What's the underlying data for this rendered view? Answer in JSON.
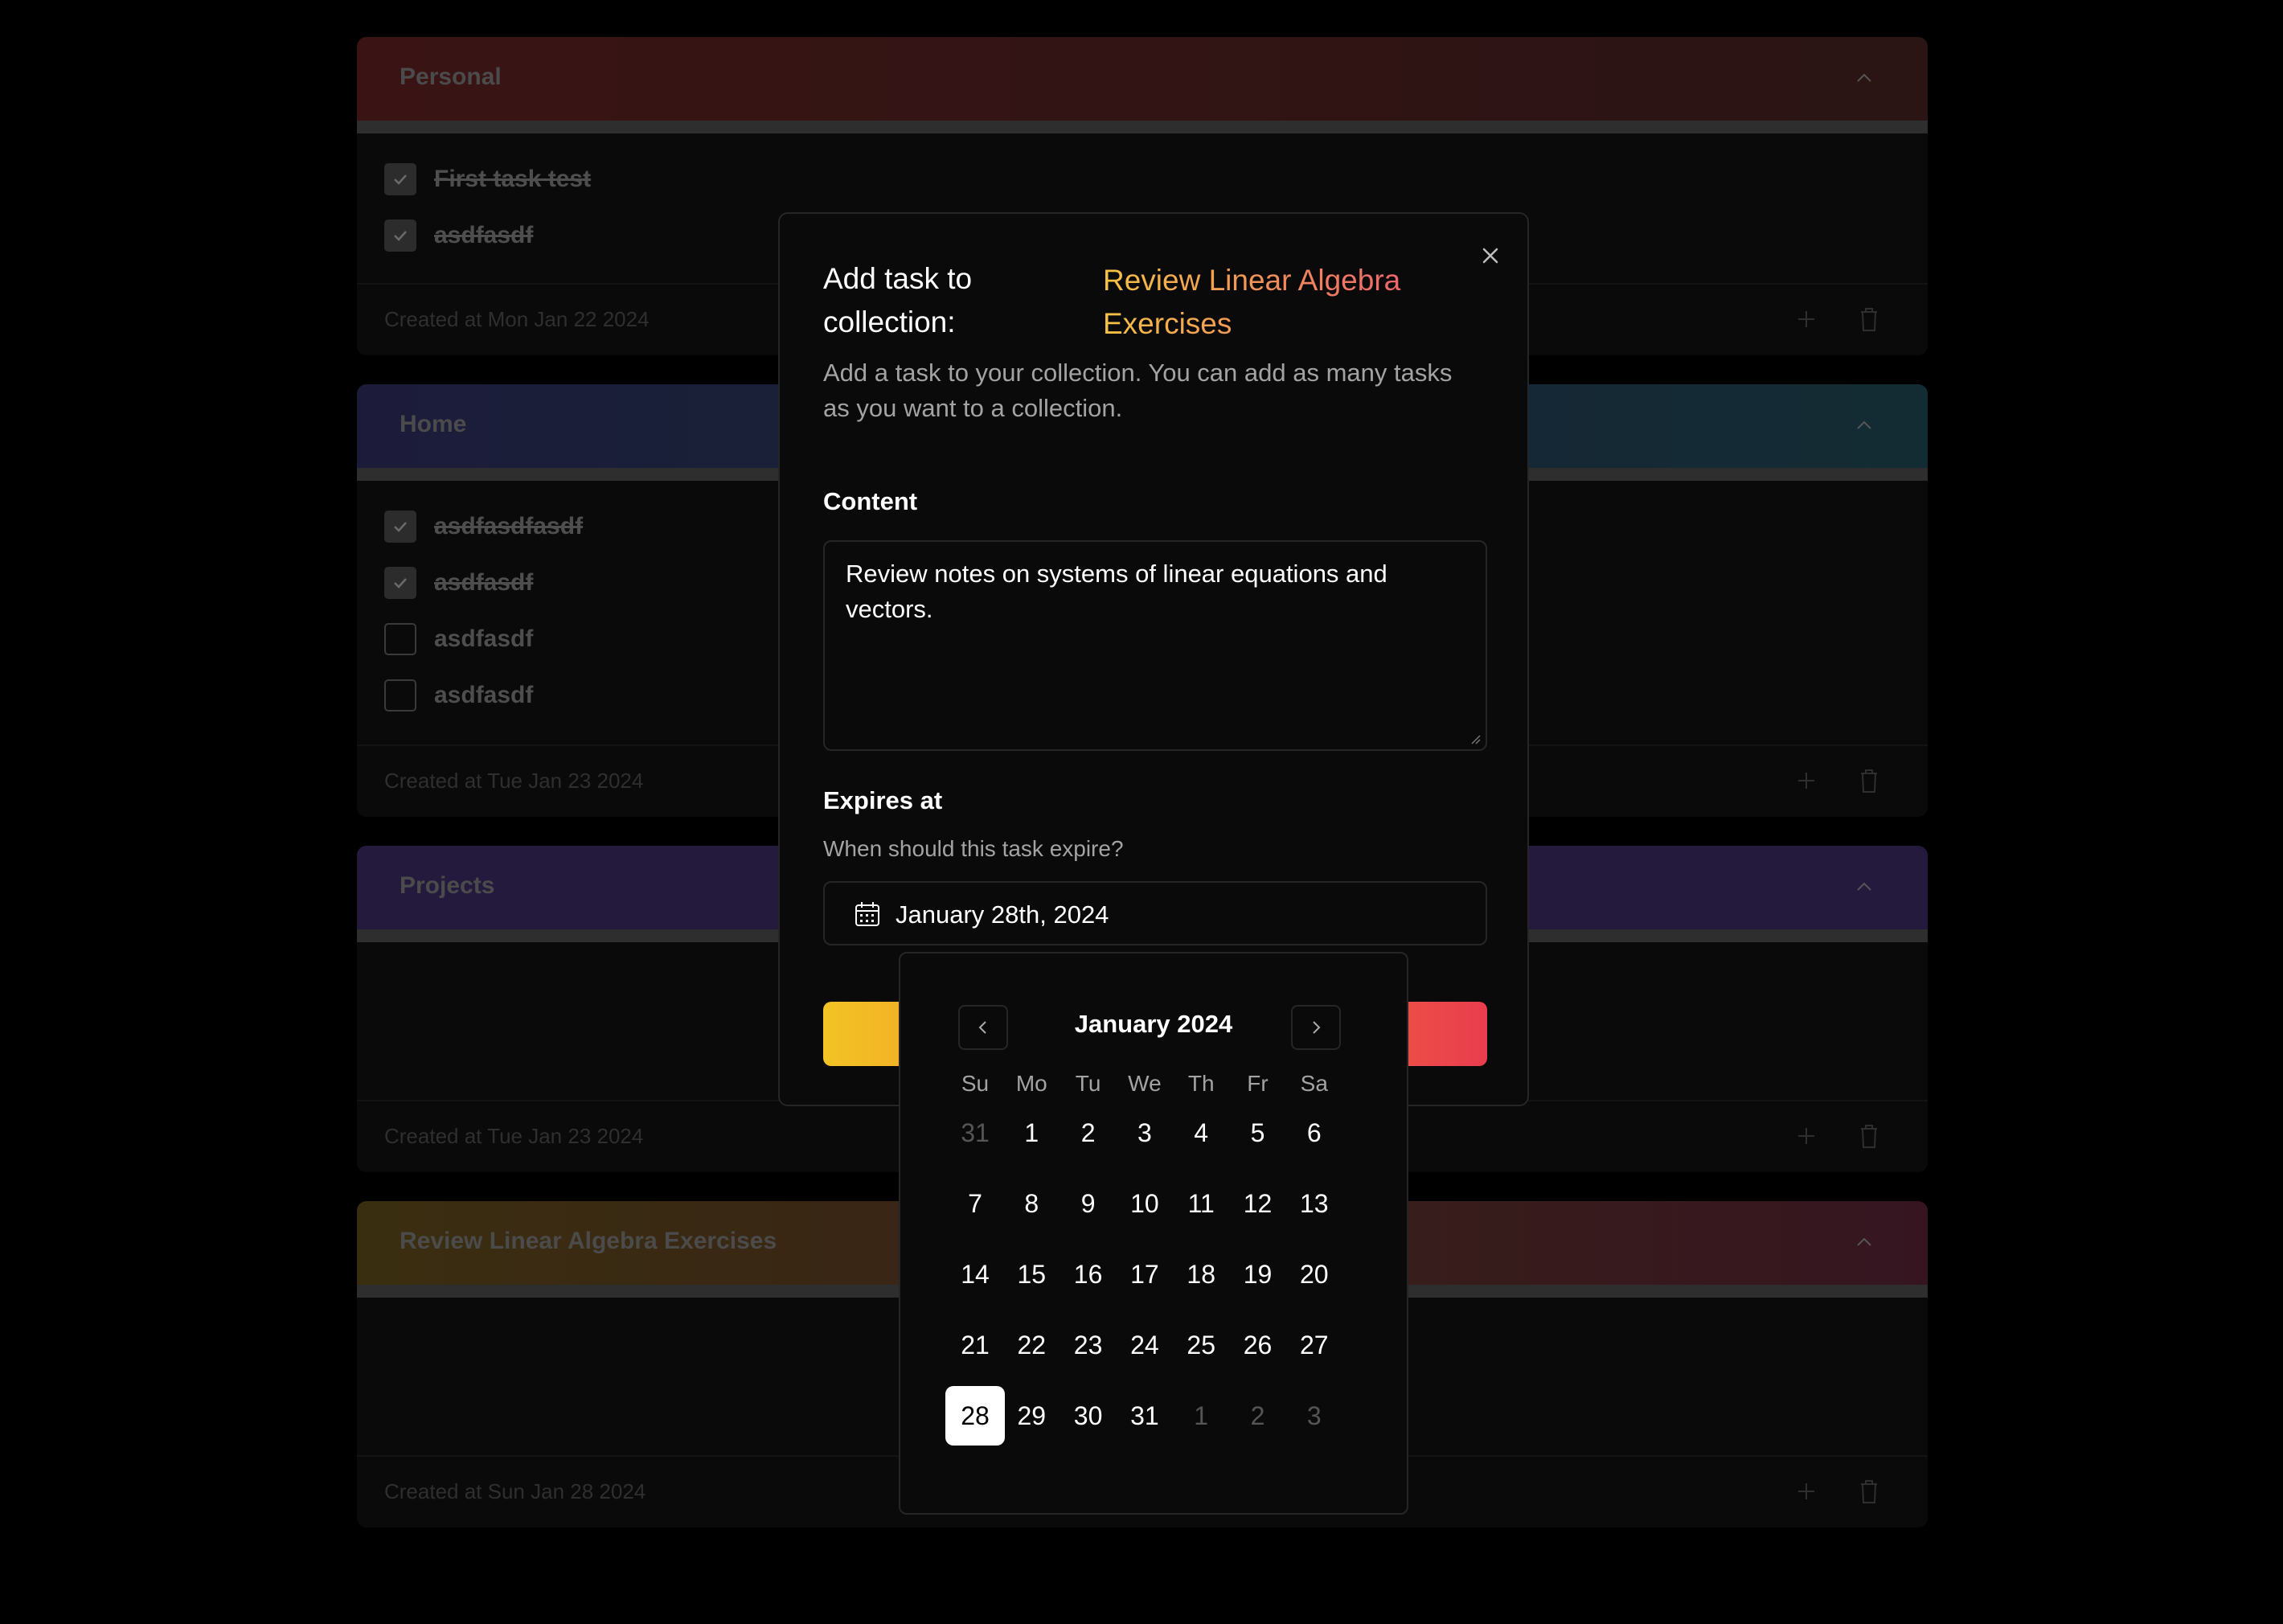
{
  "collections": [
    {
      "title": "Personal",
      "gradient": [
        "#3a1414",
        "#2a1414"
      ],
      "tasks": [
        {
          "label": "First task test",
          "done": true
        },
        {
          "label": "asdfasdf",
          "done": true
        }
      ],
      "created": "Created at Mon Jan 22 2024"
    },
    {
      "title": "Home",
      "gradient": [
        "#1c1c3a",
        "#132c33"
      ],
      "tasks": [
        {
          "label": "asdfasdfasdf",
          "done": true
        },
        {
          "label": "asdfasdf",
          "done": true
        },
        {
          "label": "asdfasdf",
          "done": false
        },
        {
          "label": "asdfasdf",
          "done": false
        }
      ],
      "created": "Created at Tue Jan 23 2024"
    },
    {
      "title": "Projects",
      "gradient": [
        "#241a3d",
        "#241a3d"
      ],
      "tasks": [],
      "created": "Created at Tue Jan 23 2024"
    },
    {
      "title": "Review Linear Algebra Exercises",
      "gradient": [
        "#3a2e10",
        "#361520"
      ],
      "tasks": [],
      "created": "Created at Sun Jan 28 2024"
    }
  ],
  "dialog": {
    "heading": "Add task to collection:",
    "collection_name": "Review Linear Algebra Exercises",
    "description": "Add a task to your collection. You can add as many tasks as you want to a collection.",
    "content_label": "Content",
    "content_value": "Review notes on systems of linear equations and vectors.",
    "expires_label": "Expires at",
    "expires_help": "When should this task expire?",
    "expires_value": "January 28th, 2024"
  },
  "calendar": {
    "month_label": "January 2024",
    "weekdays": [
      "Su",
      "Mo",
      "Tu",
      "We",
      "Th",
      "Fr",
      "Sa"
    ],
    "weeks": [
      [
        {
          "d": "31",
          "out": true
        },
        {
          "d": "1"
        },
        {
          "d": "2"
        },
        {
          "d": "3"
        },
        {
          "d": "4"
        },
        {
          "d": "5"
        },
        {
          "d": "6"
        }
      ],
      [
        {
          "d": "7"
        },
        {
          "d": "8"
        },
        {
          "d": "9"
        },
        {
          "d": "10"
        },
        {
          "d": "11"
        },
        {
          "d": "12"
        },
        {
          "d": "13"
        }
      ],
      [
        {
          "d": "14"
        },
        {
          "d": "15"
        },
        {
          "d": "16"
        },
        {
          "d": "17"
        },
        {
          "d": "18"
        },
        {
          "d": "19"
        },
        {
          "d": "20"
        }
      ],
      [
        {
          "d": "21"
        },
        {
          "d": "22"
        },
        {
          "d": "23"
        },
        {
          "d": "24"
        },
        {
          "d": "25"
        },
        {
          "d": "26"
        },
        {
          "d": "27"
        }
      ],
      [
        {
          "d": "28",
          "selected": true
        },
        {
          "d": "29"
        },
        {
          "d": "30"
        },
        {
          "d": "31"
        },
        {
          "d": "1",
          "out": true
        },
        {
          "d": "2",
          "out": true
        },
        {
          "d": "3",
          "out": true
        }
      ]
    ]
  }
}
